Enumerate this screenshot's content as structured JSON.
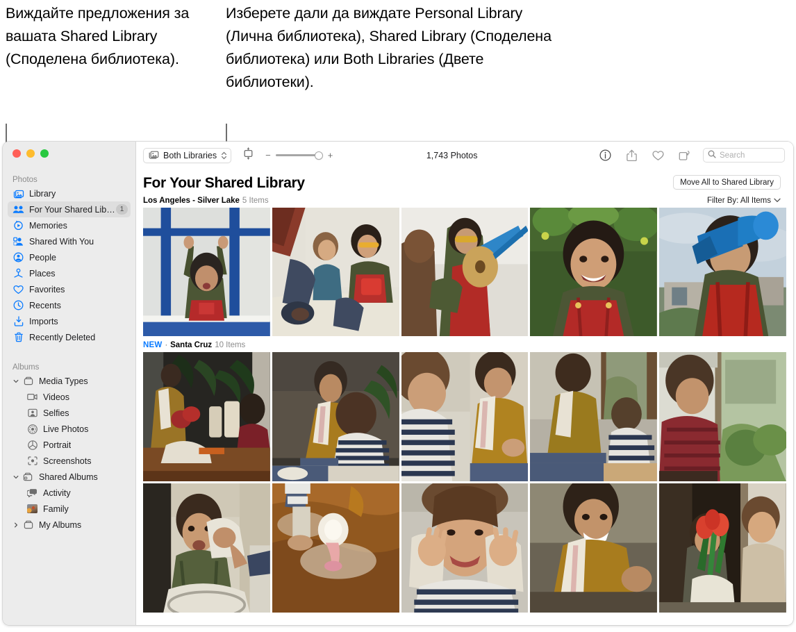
{
  "callouts": {
    "left": "Виждайте предложения за вашата Shared Library (Споделена библиотека).",
    "right": "Изберете дали да виждате Personal Library (Лична библиотека), Shared Library (Споделена библиотека) или Both Libraries (Двете библиотеки)."
  },
  "window": {
    "traffic_lights": [
      "close",
      "minimize",
      "zoom"
    ]
  },
  "sidebar": {
    "sections": [
      {
        "title": "Photos",
        "items": [
          {
            "label": "Library",
            "icon": "library-icon",
            "selected": false
          },
          {
            "label": "For Your Shared Library",
            "icon": "shared-library-icon",
            "selected": true,
            "badge": "1"
          },
          {
            "label": "Memories",
            "icon": "memories-icon",
            "selected": false
          },
          {
            "label": "Shared With You",
            "icon": "shared-with-you-icon",
            "selected": false
          },
          {
            "label": "People",
            "icon": "people-icon",
            "selected": false
          },
          {
            "label": "Places",
            "icon": "places-icon",
            "selected": false
          },
          {
            "label": "Favorites",
            "icon": "heart-icon",
            "selected": false
          },
          {
            "label": "Recents",
            "icon": "clock-icon",
            "selected": false
          },
          {
            "label": "Imports",
            "icon": "import-icon",
            "selected": false
          },
          {
            "label": "Recently Deleted",
            "icon": "trash-icon",
            "selected": false
          }
        ]
      },
      {
        "title": "Albums",
        "items": [
          {
            "label": "Media Types",
            "icon": "folder-icon",
            "disclosure": "expanded"
          },
          {
            "label": "Videos",
            "icon": "video-icon",
            "indent": true
          },
          {
            "label": "Selfies",
            "icon": "selfie-icon",
            "indent": true
          },
          {
            "label": "Live Photos",
            "icon": "live-photo-icon",
            "indent": true
          },
          {
            "label": "Portrait",
            "icon": "portrait-icon",
            "indent": true
          },
          {
            "label": "Screenshots",
            "icon": "screenshot-icon",
            "indent": true
          },
          {
            "label": "Shared Albums",
            "icon": "shared-folder-icon",
            "disclosure": "expanded"
          },
          {
            "label": "Activity",
            "icon": "activity-icon",
            "indent": true
          },
          {
            "label": "Family",
            "icon": "album-thumbnail",
            "indent": true
          },
          {
            "label": "My Albums",
            "icon": "folder-icon",
            "disclosure": "collapsed"
          }
        ]
      }
    ]
  },
  "toolbar": {
    "library_selector": {
      "label": "Both Libraries",
      "icon": "photos-stack-icon"
    },
    "aspect_button": {
      "icon": "aspect-ratio-icon"
    },
    "zoom": {
      "minus": "−",
      "plus": "+",
      "value": 100
    },
    "photo_count": "1,743 Photos",
    "icons": [
      {
        "name": "info-icon",
        "label": "Info"
      },
      {
        "name": "share-icon",
        "label": "Share"
      },
      {
        "name": "favorite-heart-icon",
        "label": "Favorite"
      },
      {
        "name": "rotate-icon",
        "label": "Rotate"
      }
    ],
    "search": {
      "placeholder": "Search",
      "value": "",
      "icon": "search-icon"
    }
  },
  "main": {
    "page_title": "For Your Shared Library",
    "move_all_button": "Move All to Shared Library",
    "filter_by": "Filter By: All Items",
    "sections": [
      {
        "new_badge": "",
        "separator": "",
        "name": "Los Angeles - Silver Lake",
        "count": "5 Items",
        "rows": 1
      },
      {
        "new_badge": "NEW",
        "separator": "·",
        "name": "Santa Cruz",
        "count": "10 Items",
        "rows": 2
      }
    ]
  },
  "colors": {
    "accent_blue": "#0a7bff",
    "sidebar_bg": "#ececec",
    "selected_row": "#dedede",
    "window_bg": "#ffffff"
  }
}
